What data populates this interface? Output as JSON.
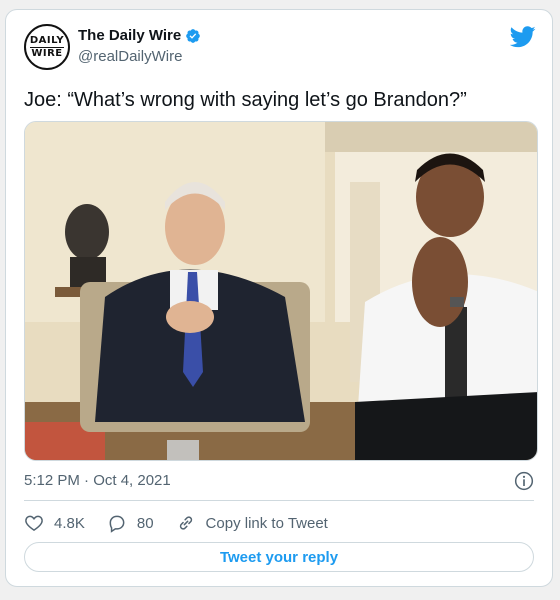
{
  "tweet": {
    "author": {
      "display_name": "The Daily Wire",
      "handle": "@realDailyWire",
      "avatar_text_top": "DAILY",
      "avatar_text_bottom": "WIRE",
      "verified": true
    },
    "text": "Joe: “What’s wrong with saying let’s go Brandon?”",
    "media": {
      "type": "photo",
      "icon": "photo"
    },
    "timestamp": "5:12 PM · Oct 4, 2021",
    "actions": {
      "likes": "4.8K",
      "replies": "80",
      "copy_link_label": "Copy link to Tweet"
    },
    "reply_button_label": "Tweet your reply"
  },
  "colors": {
    "brand_blue": "#1d9bf0",
    "text_primary": "#0f1419",
    "text_secondary": "#536471",
    "border": "#cfd9de"
  },
  "icons": {
    "platform": "twitter-bird-icon",
    "verified": "verified-badge-icon",
    "info": "info-icon",
    "like": "heart-icon",
    "reply": "reply-bubble-icon",
    "copy": "link-icon"
  }
}
